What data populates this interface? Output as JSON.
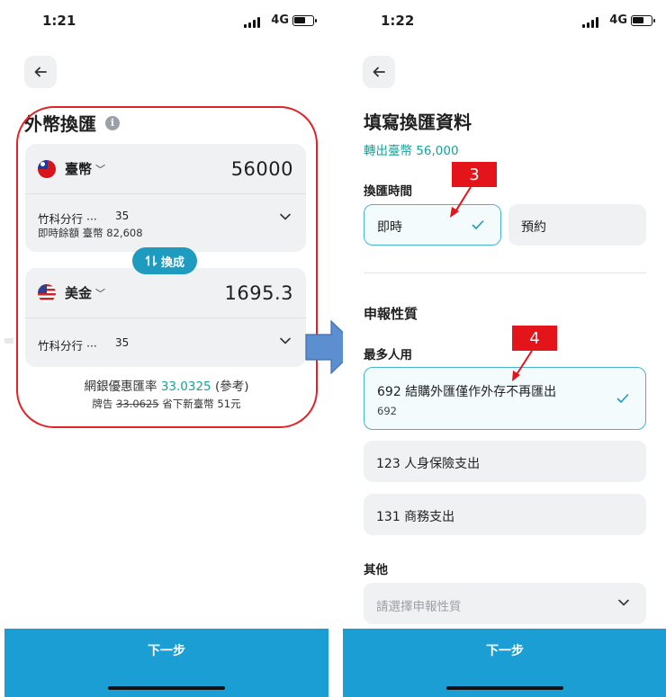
{
  "left_screen": {
    "status": {
      "time": "1:21",
      "network": "4G"
    },
    "title": "外幣換匯",
    "from": {
      "currency": "臺幣",
      "amount": "56000",
      "account_name": "竹科分行 ···",
      "account_no": "35",
      "balance": "即時餘額 臺幣 82,608"
    },
    "swap_label": "換成",
    "to": {
      "currency": "美金",
      "amount": "1695.3",
      "account_name": "竹科分行 ···",
      "account_no": "35"
    },
    "rate": {
      "prefix": "網銀優惠匯率",
      "value": "33.0325",
      "suffix": "(參考)",
      "board_label": "牌告",
      "board_value": "33.0625",
      "saving": "省下新臺幣 51元"
    },
    "next_label": "下一步"
  },
  "right_screen": {
    "status": {
      "time": "1:22",
      "network": "4G"
    },
    "title": "填寫換匯資料",
    "subtitle": "轉出臺幣 56,000",
    "time_section_label": "換匯時間",
    "time_options": [
      {
        "label": "即時",
        "selected": true
      },
      {
        "label": "預約",
        "selected": false
      }
    ],
    "nature_section_label": "申報性質",
    "most_used_label": "最多人用",
    "nature_options": [
      {
        "label": "692 結購外匯僅作外存不再匯出",
        "code": "692",
        "selected": true
      },
      {
        "label": "123 人身保險支出",
        "selected": false
      },
      {
        "label": "131 商務支出",
        "selected": false
      }
    ],
    "other_label": "其他",
    "select_placeholder": "請選擇申報性質",
    "next_label": "下一步"
  },
  "annotations": {
    "step3": "3",
    "step4": "4"
  },
  "colors": {
    "accent": "#1a9ed4",
    "teal": "#14a39b",
    "highlight": "#e0232a",
    "arrow": "#5b8fd0"
  }
}
